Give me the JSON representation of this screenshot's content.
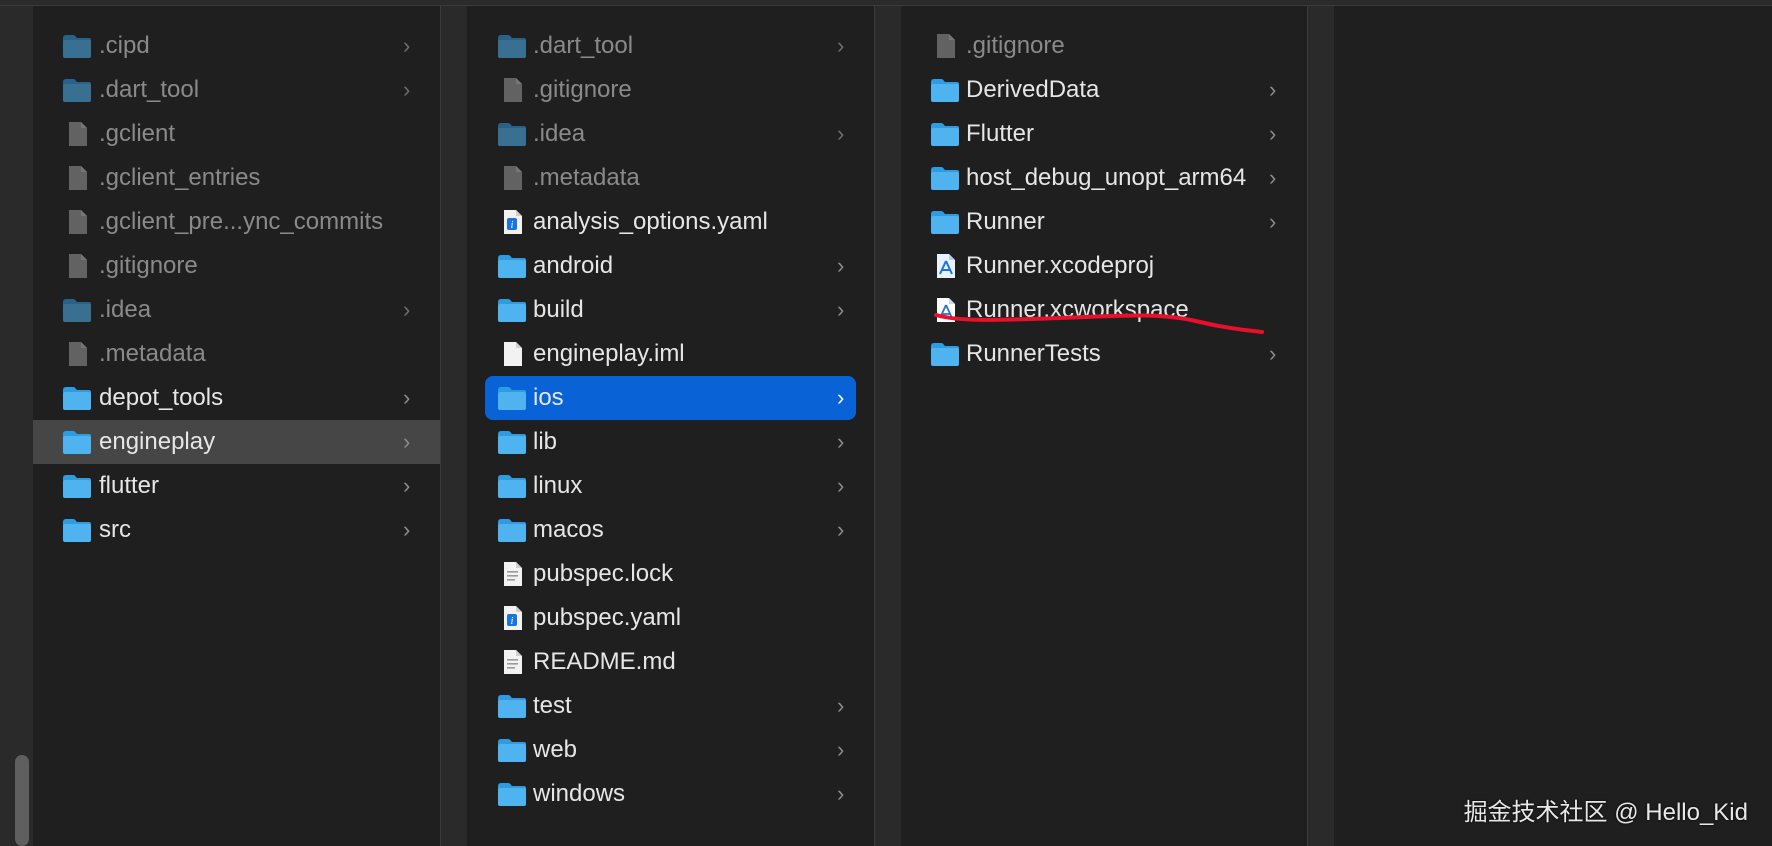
{
  "columns": [
    {
      "items": [
        {
          "label": ".cipd",
          "icon": "folder-icon",
          "dim": true,
          "chevron": true
        },
        {
          "label": ".dart_tool",
          "icon": "folder-icon",
          "dim": true,
          "chevron": true
        },
        {
          "label": ".gclient",
          "icon": "file-icon",
          "dim": true,
          "chevron": false
        },
        {
          "label": ".gclient_entries",
          "icon": "file-icon",
          "dim": true,
          "chevron": false
        },
        {
          "label": ".gclient_pre...ync_commits",
          "icon": "file-icon",
          "dim": true,
          "chevron": false
        },
        {
          "label": ".gitignore",
          "icon": "file-icon",
          "dim": true,
          "chevron": false
        },
        {
          "label": ".idea",
          "icon": "folder-icon",
          "dim": true,
          "chevron": true
        },
        {
          "label": ".metadata",
          "icon": "file-icon",
          "dim": true,
          "chevron": false
        },
        {
          "label": "depot_tools",
          "icon": "folder-icon",
          "dim": false,
          "chevron": true
        },
        {
          "label": "engineplay",
          "icon": "folder-icon",
          "dim": false,
          "chevron": true,
          "selected": "grey"
        },
        {
          "label": "flutter",
          "icon": "folder-icon",
          "dim": false,
          "chevron": true
        },
        {
          "label": "src",
          "icon": "folder-icon",
          "dim": false,
          "chevron": true
        }
      ]
    },
    {
      "items": [
        {
          "label": ".dart_tool",
          "icon": "folder-icon",
          "dim": true,
          "chevron": true
        },
        {
          "label": ".gitignore",
          "icon": "file-icon",
          "dim": true,
          "chevron": false
        },
        {
          "label": ".idea",
          "icon": "folder-icon",
          "dim": true,
          "chevron": true
        },
        {
          "label": ".metadata",
          "icon": "file-icon",
          "dim": true,
          "chevron": false
        },
        {
          "label": "analysis_options.yaml",
          "icon": "yaml-file-icon",
          "dim": false,
          "chevron": false
        },
        {
          "label": "android",
          "icon": "folder-icon",
          "dim": false,
          "chevron": true
        },
        {
          "label": "build",
          "icon": "folder-icon",
          "dim": false,
          "chevron": true
        },
        {
          "label": "engineplay.iml",
          "icon": "blank-file-icon",
          "dim": false,
          "chevron": false
        },
        {
          "label": "ios",
          "icon": "folder-icon",
          "dim": false,
          "chevron": true,
          "selected": "blue"
        },
        {
          "label": "lib",
          "icon": "folder-icon",
          "dim": false,
          "chevron": true
        },
        {
          "label": "linux",
          "icon": "folder-icon",
          "dim": false,
          "chevron": true
        },
        {
          "label": "macos",
          "icon": "folder-icon",
          "dim": false,
          "chevron": true
        },
        {
          "label": "pubspec.lock",
          "icon": "text-file-icon",
          "dim": false,
          "chevron": false
        },
        {
          "label": "pubspec.yaml",
          "icon": "yaml-file-icon",
          "dim": false,
          "chevron": false
        },
        {
          "label": "README.md",
          "icon": "text-file-icon",
          "dim": false,
          "chevron": false
        },
        {
          "label": "test",
          "icon": "folder-icon",
          "dim": false,
          "chevron": true
        },
        {
          "label": "web",
          "icon": "folder-icon",
          "dim": false,
          "chevron": true
        },
        {
          "label": "windows",
          "icon": "folder-icon",
          "dim": false,
          "chevron": true
        }
      ]
    },
    {
      "items": [
        {
          "label": ".gitignore",
          "icon": "file-icon",
          "dim": true,
          "chevron": false
        },
        {
          "label": "DerivedData",
          "icon": "folder-icon",
          "dim": false,
          "chevron": true
        },
        {
          "label": "Flutter",
          "icon": "folder-icon",
          "dim": false,
          "chevron": true
        },
        {
          "label": "host_debug_unopt_arm64",
          "icon": "folder-icon",
          "dim": false,
          "chevron": true
        },
        {
          "label": "Runner",
          "icon": "folder-icon",
          "dim": false,
          "chevron": true
        },
        {
          "label": "Runner.xcodeproj",
          "icon": "xcode-project-icon",
          "dim": false,
          "chevron": false
        },
        {
          "label": "Runner.xcworkspace",
          "icon": "xcode-workspace-icon",
          "dim": false,
          "chevron": false
        },
        {
          "label": "RunnerTests",
          "icon": "folder-icon",
          "dim": false,
          "chevron": true
        }
      ]
    }
  ],
  "chevron_glyph": "›",
  "watermark": "掘金技术社区 @ Hello_Kid",
  "colors": {
    "folder": "#4fb3f0",
    "folder_tab": "#2f9be0",
    "selection_blue": "#0a63d6",
    "selection_grey": "#464646",
    "annotation_red": "#e8102a"
  }
}
